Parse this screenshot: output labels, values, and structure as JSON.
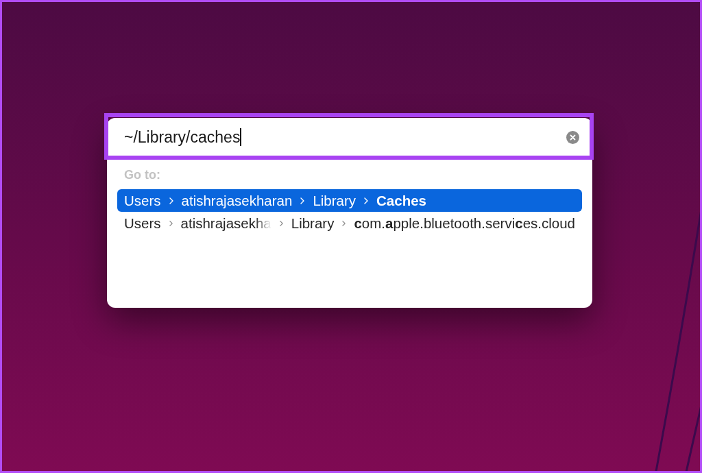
{
  "go_to_dialog": {
    "highlighted": true,
    "path_field": {
      "value": "~/Library/caches",
      "focused": true
    },
    "section_label": "Go to:",
    "results": [
      {
        "selected": true,
        "segments": [
          {
            "text": "Users",
            "bold": false,
            "truncated": false
          },
          {
            "text": "atishrajasekharan",
            "bold": false,
            "truncated": false
          },
          {
            "text": "Library",
            "bold": false,
            "truncated": false
          },
          {
            "text": "Caches",
            "bold": true,
            "truncated": false
          }
        ]
      },
      {
        "selected": false,
        "segments": [
          {
            "text": "Users",
            "bold": false,
            "truncated": false
          },
          {
            "text": "atishrajasekha",
            "bold": false,
            "truncated": true
          },
          {
            "text": "Library",
            "bold": false,
            "truncated": false
          },
          {
            "text": "**c**om.**a**pple.bluetooth.servi**c**es.cloud",
            "bold": false,
            "truncated": false
          }
        ]
      }
    ]
  }
}
